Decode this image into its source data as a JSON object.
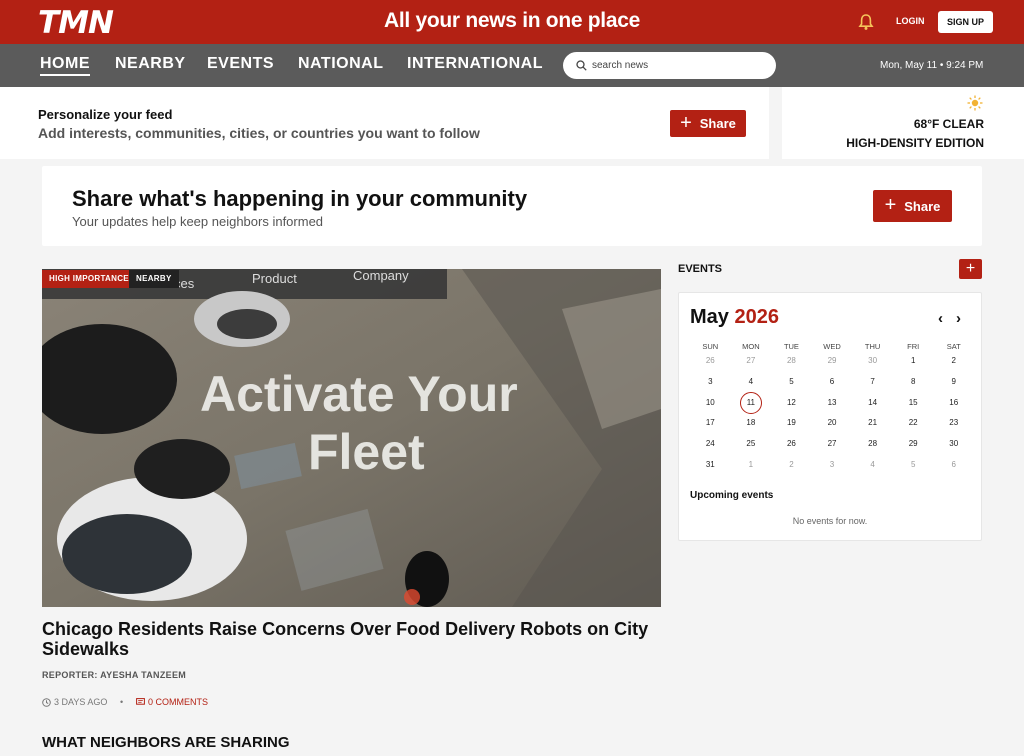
{
  "brand": {
    "logo_text": "TMN",
    "tagline": "All your news in one place",
    "accent": "#b32114"
  },
  "header": {
    "login_label": "LOGIN",
    "signup_label": "SIGN UP"
  },
  "nav": {
    "items": [
      {
        "label": "HOME",
        "active": true
      },
      {
        "label": "NEARBY"
      },
      {
        "label": "EVENTS"
      },
      {
        "label": "NATIONAL"
      },
      {
        "label": "INTERNATIONAL"
      }
    ],
    "search_placeholder": "search news",
    "datetime": "Mon, May 11 • 9:24 PM"
  },
  "personalize": {
    "title": "Personalize your feed",
    "subtitle": "Add interests, communities, cities, or countries you want to follow",
    "button_label": "Share"
  },
  "weather": {
    "icon": "sun-icon",
    "temp": "68°F CLEAR",
    "edition": "HIGH-DENSITY EDITION"
  },
  "share_card": {
    "title": "Share what's happening in your community",
    "subtitle": "Your updates help keep neighbors informed",
    "button_label": "Share"
  },
  "featured": {
    "badges": [
      "HIGH IMPORTANCE",
      "NEARBY"
    ],
    "image_text": {
      "menu": [
        "ces",
        "Product",
        "Company"
      ],
      "line1": "Activate Your",
      "line2": "Fleet"
    },
    "headline": "Chicago Residents Raise Concerns Over Food Delivery Robots on City Sidewalks",
    "reporter": "REPORTER: AYESHA TANZEEM",
    "time_ago": "3 DAYS AGO",
    "comments": "0 COMMENTS"
  },
  "neighbors_title": "WHAT NEIGHBORS ARE SHARING",
  "events": {
    "title": "EVENTS",
    "add_label": "+",
    "calendar": {
      "month": "May",
      "year": "2026",
      "weekdays": [
        "SUN",
        "MON",
        "TUE",
        "WED",
        "THU",
        "FRI",
        "SAT"
      ],
      "weeks": [
        [
          {
            "d": "26",
            "m": true
          },
          {
            "d": "27",
            "m": true
          },
          {
            "d": "28",
            "m": true
          },
          {
            "d": "29",
            "m": true
          },
          {
            "d": "30",
            "m": true
          },
          {
            "d": "1"
          },
          {
            "d": "2"
          }
        ],
        [
          {
            "d": "3"
          },
          {
            "d": "4"
          },
          {
            "d": "5"
          },
          {
            "d": "6"
          },
          {
            "d": "7"
          },
          {
            "d": "8"
          },
          {
            "d": "9"
          }
        ],
        [
          {
            "d": "10"
          },
          {
            "d": "11",
            "today": true
          },
          {
            "d": "12"
          },
          {
            "d": "13"
          },
          {
            "d": "14"
          },
          {
            "d": "15"
          },
          {
            "d": "16"
          }
        ],
        [
          {
            "d": "17"
          },
          {
            "d": "18"
          },
          {
            "d": "19"
          },
          {
            "d": "20"
          },
          {
            "d": "21"
          },
          {
            "d": "22"
          },
          {
            "d": "23"
          }
        ],
        [
          {
            "d": "24"
          },
          {
            "d": "25"
          },
          {
            "d": "26"
          },
          {
            "d": "27"
          },
          {
            "d": "28"
          },
          {
            "d": "29"
          },
          {
            "d": "30"
          }
        ],
        [
          {
            "d": "31"
          },
          {
            "d": "1",
            "m": true
          },
          {
            "d": "2",
            "m": true
          },
          {
            "d": "3",
            "m": true
          },
          {
            "d": "4",
            "m": true
          },
          {
            "d": "5",
            "m": true
          },
          {
            "d": "6",
            "m": true
          }
        ]
      ]
    },
    "upcoming_title": "Upcoming events",
    "no_events": "No events for now."
  }
}
